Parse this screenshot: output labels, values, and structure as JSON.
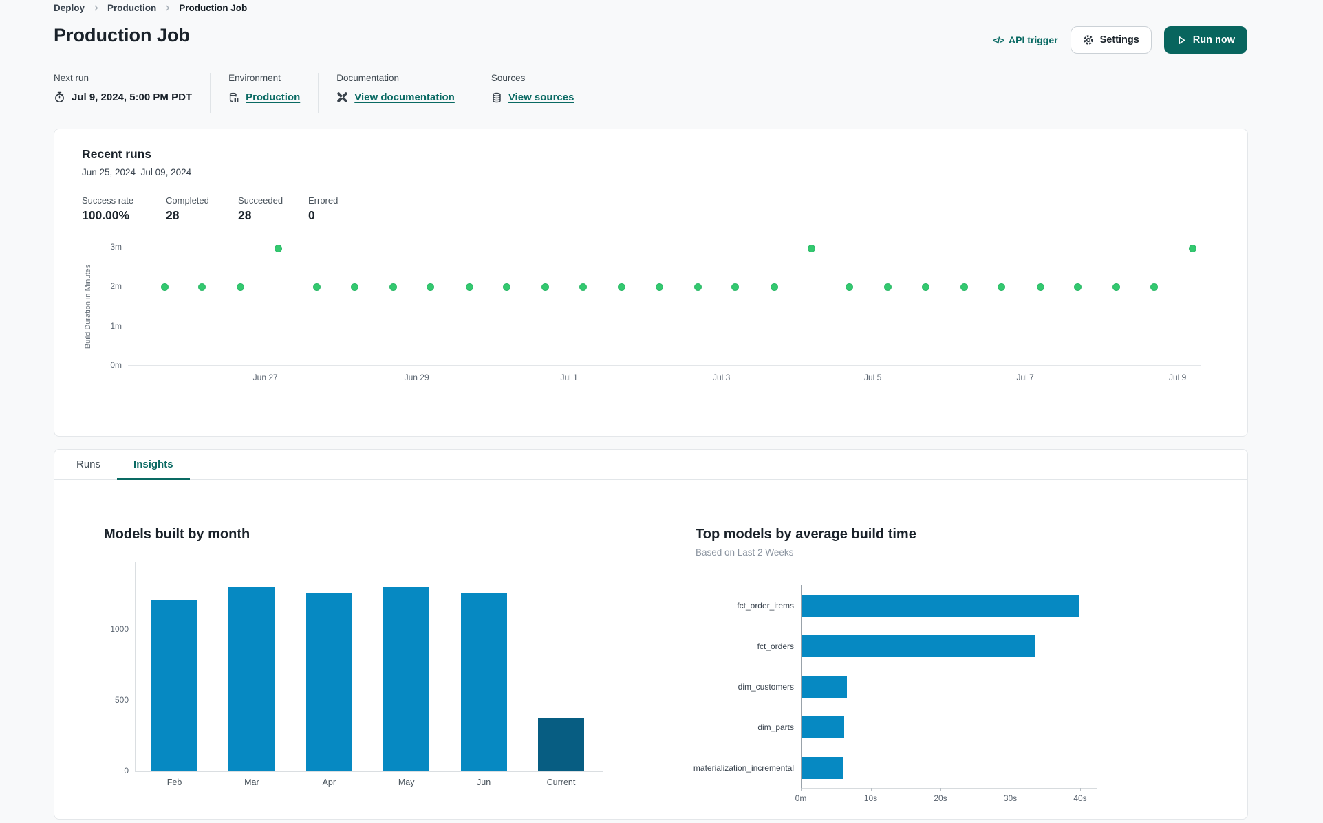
{
  "breadcrumb": {
    "items": [
      "Deploy",
      "Production",
      "Production Job"
    ]
  },
  "page": {
    "title": "Production Job"
  },
  "actions": {
    "api_trigger": "API trigger",
    "api_trigger_glyph": "</>",
    "settings": "Settings",
    "run_now": "Run now"
  },
  "meta": {
    "next_run": {
      "label": "Next run",
      "value": "Jul 9, 2024, 5:00 PM PDT",
      "icon": "stopwatch-icon"
    },
    "environment": {
      "label": "Environment",
      "link": "Production",
      "icon": "environment-icon"
    },
    "documentation": {
      "label": "Documentation",
      "link": "View documentation",
      "icon": "dbt-logo-icon"
    },
    "sources": {
      "label": "Sources",
      "link": "View sources",
      "icon": "database-icon"
    }
  },
  "recent_runs": {
    "title": "Recent runs",
    "date_range": "Jun 25, 2024–Jul 09, 2024",
    "stats": [
      {
        "label": "Success rate",
        "value": "100.00%"
      },
      {
        "label": "Completed",
        "value": "28"
      },
      {
        "label": "Succeeded",
        "value": "28"
      },
      {
        "label": "Errored",
        "value": "0"
      }
    ]
  },
  "tabs": [
    {
      "label": "Runs",
      "active": false
    },
    {
      "label": "Insights",
      "active": true
    }
  ],
  "colors": {
    "accent_teal": "#0A6A63",
    "button_teal": "#08655E",
    "run_dot_green": "#33C96F",
    "bar_blue": "#0689C2",
    "bar_navy": "#075D82"
  },
  "chart_data": [
    {
      "id": "recent_runs_scatter",
      "type": "scatter",
      "title": "Recent runs",
      "ylabel": "Build Duration in Minutes",
      "ylim": [
        0,
        3
      ],
      "yticks": [
        "0m",
        "1m",
        "2m",
        "3m"
      ],
      "x_range": [
        "Jun 25, 2024",
        "Jul 09, 2024"
      ],
      "xticks": [
        "Jun 27",
        "Jun 29",
        "Jul 1",
        "Jul 3",
        "Jul 5",
        "Jul 7",
        "Jul 9"
      ],
      "xtick_fracs": [
        0.128,
        0.269,
        0.411,
        0.553,
        0.694,
        0.836,
        0.978
      ],
      "grid": false,
      "points": [
        [
          0.034,
          2.0
        ],
        [
          0.069,
          2.0
        ],
        [
          0.105,
          2.0
        ],
        [
          0.14,
          2.98
        ],
        [
          0.176,
          2.0
        ],
        [
          0.211,
          2.0
        ],
        [
          0.247,
          2.0
        ],
        [
          0.282,
          2.0
        ],
        [
          0.318,
          2.0
        ],
        [
          0.353,
          2.0
        ],
        [
          0.389,
          2.0
        ],
        [
          0.424,
          2.0
        ],
        [
          0.46,
          2.0
        ],
        [
          0.495,
          2.0
        ],
        [
          0.531,
          2.0
        ],
        [
          0.566,
          2.0
        ],
        [
          0.602,
          2.0
        ],
        [
          0.637,
          2.98
        ],
        [
          0.672,
          2.0
        ],
        [
          0.708,
          2.0
        ],
        [
          0.743,
          2.0
        ],
        [
          0.779,
          2.0
        ],
        [
          0.814,
          2.0
        ],
        [
          0.85,
          2.0
        ],
        [
          0.885,
          2.0
        ],
        [
          0.921,
          2.0
        ],
        [
          0.956,
          2.0
        ],
        [
          0.992,
          2.98
        ]
      ]
    },
    {
      "id": "models_built_by_month",
      "type": "bar",
      "title": "Models built by month",
      "categories": [
        "Feb",
        "Mar",
        "Apr",
        "May",
        "Jun",
        "Current"
      ],
      "values": [
        1210,
        1300,
        1260,
        1300,
        1260,
        380
      ],
      "yticks": [
        0,
        500,
        1000
      ],
      "ylim": [
        0,
        1480
      ],
      "grid": false,
      "highlight_index": 5
    },
    {
      "id": "top_models_by_avg_build_time",
      "type": "bar-horizontal",
      "title": "Top models by average build time",
      "subtitle": "Based on Last 2 Weeks",
      "categories": [
        "fct_order_items",
        "fct_orders",
        "dim_customers",
        "dim_parts",
        "materialization_incremental"
      ],
      "values_seconds": [
        39.7,
        33.4,
        6.5,
        6.1,
        5.9
      ],
      "xticks": [
        "0m",
        "10s",
        "20s",
        "30s",
        "40s"
      ],
      "xtick_seconds": [
        0,
        10,
        20,
        30,
        40
      ],
      "xlim": [
        0,
        42
      ],
      "grid": false
    }
  ]
}
